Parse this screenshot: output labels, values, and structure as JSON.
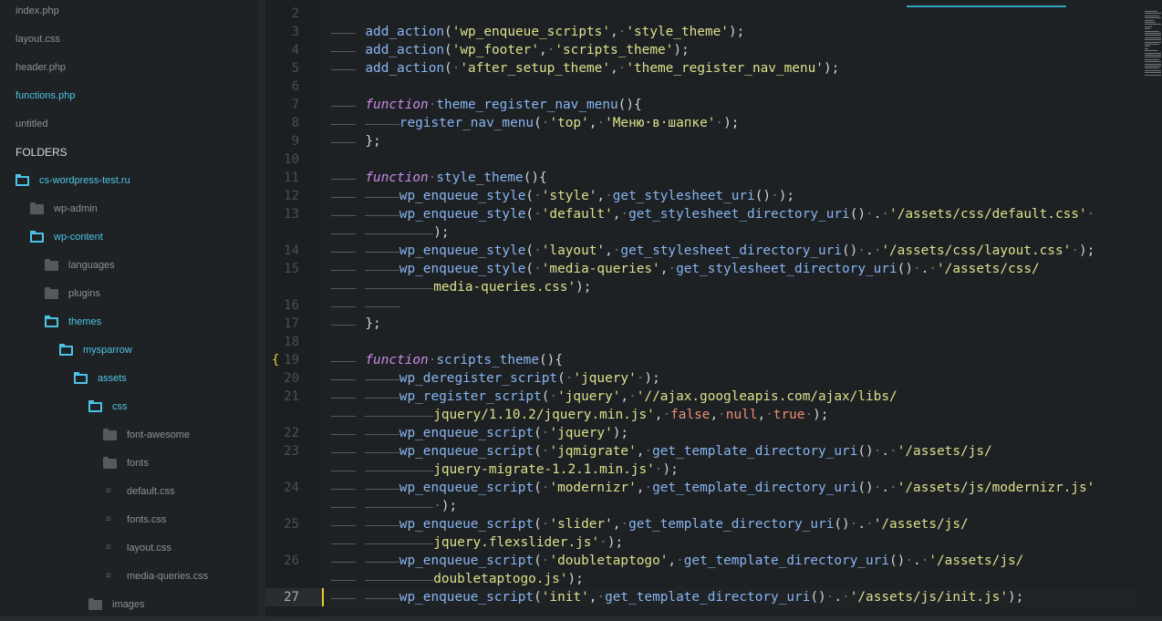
{
  "sidebar": {
    "open_files": [
      {
        "label": "index.php",
        "active": false
      },
      {
        "label": "layout.css",
        "active": false
      },
      {
        "label": "header.php",
        "active": false
      },
      {
        "label": "functions.php",
        "active": true
      },
      {
        "label": "untitled",
        "active": false
      }
    ],
    "folders_header": "FOLDERS",
    "tree": [
      {
        "label": "cs-wordpress-test.ru",
        "kind": "folder-open",
        "depth": 0
      },
      {
        "label": "wp-admin",
        "kind": "folder",
        "depth": 1
      },
      {
        "label": "wp-content",
        "kind": "folder-open",
        "depth": 1
      },
      {
        "label": "languages",
        "kind": "folder",
        "depth": 2
      },
      {
        "label": "plugins",
        "kind": "folder",
        "depth": 2
      },
      {
        "label": "themes",
        "kind": "folder-open",
        "depth": 2
      },
      {
        "label": "mysparrow",
        "kind": "folder-open",
        "depth": 3
      },
      {
        "label": "assets",
        "kind": "folder-open",
        "depth": 4
      },
      {
        "label": "css",
        "kind": "folder-open",
        "depth": 5
      },
      {
        "label": "font-awesome",
        "kind": "folder",
        "depth": 6
      },
      {
        "label": "fonts",
        "kind": "folder",
        "depth": 6
      },
      {
        "label": "default.css",
        "kind": "file",
        "depth": 6
      },
      {
        "label": "fonts.css",
        "kind": "file",
        "depth": 6
      },
      {
        "label": "layout.css",
        "kind": "file",
        "depth": 6
      },
      {
        "label": "media-queries.css",
        "kind": "file",
        "depth": 6
      },
      {
        "label": "images",
        "kind": "folder",
        "depth": 5
      }
    ]
  },
  "editor": {
    "current_line": 27,
    "fold_marker": "{",
    "fold_line": 19,
    "lines": [
      {
        "n": 2,
        "indent": 0,
        "tokens": []
      },
      {
        "n": 3,
        "indent": 1,
        "tokens": [
          [
            "fn",
            "add_action"
          ],
          [
            "p",
            "("
          ],
          [
            "str",
            "'wp_enqueue_scripts'"
          ],
          [
            "p",
            ","
          ],
          [
            "dot",
            "·"
          ],
          [
            "str",
            "'style_theme'"
          ],
          [
            "p",
            ");"
          ]
        ]
      },
      {
        "n": 4,
        "indent": 1,
        "tokens": [
          [
            "fn",
            "add_action"
          ],
          [
            "p",
            "("
          ],
          [
            "str",
            "'wp_footer'"
          ],
          [
            "p",
            ","
          ],
          [
            "dot",
            "·"
          ],
          [
            "str",
            "'scripts_theme'"
          ],
          [
            "p",
            ");"
          ]
        ]
      },
      {
        "n": 5,
        "indent": 1,
        "tokens": [
          [
            "fn",
            "add_action"
          ],
          [
            "p",
            "("
          ],
          [
            "dot",
            "·"
          ],
          [
            "str",
            "'after_setup_theme'"
          ],
          [
            "p",
            ","
          ],
          [
            "dot",
            "·"
          ],
          [
            "str",
            "'theme_register_nav_menu'"
          ],
          [
            "p",
            ");"
          ]
        ]
      },
      {
        "n": 6,
        "indent": 0,
        "tokens": []
      },
      {
        "n": 7,
        "indent": 1,
        "tokens": [
          [
            "kw",
            "function"
          ],
          [
            "dot",
            "·"
          ],
          [
            "fn",
            "theme_register_nav_menu"
          ],
          [
            "p",
            "(){"
          ]
        ]
      },
      {
        "n": 8,
        "indent": 2,
        "tokens": [
          [
            "fn",
            "register_nav_menu"
          ],
          [
            "p",
            "("
          ],
          [
            "dot",
            "·"
          ],
          [
            "str",
            "'top'"
          ],
          [
            "p",
            ","
          ],
          [
            "dot",
            "·"
          ],
          [
            "str",
            "'Меню·в·шапке'"
          ],
          [
            "dot",
            "·"
          ],
          [
            "p",
            ");"
          ]
        ]
      },
      {
        "n": 9,
        "indent": 1,
        "tokens": [
          [
            "p",
            "};"
          ]
        ]
      },
      {
        "n": 10,
        "indent": 0,
        "tokens": []
      },
      {
        "n": 11,
        "indent": 1,
        "tokens": [
          [
            "kw",
            "function"
          ],
          [
            "dot",
            "·"
          ],
          [
            "fn",
            "style_theme"
          ],
          [
            "p",
            "(){"
          ]
        ]
      },
      {
        "n": 12,
        "indent": 2,
        "tokens": [
          [
            "fn",
            "wp_enqueue_style"
          ],
          [
            "p",
            "("
          ],
          [
            "dot",
            "·"
          ],
          [
            "str",
            "'style'"
          ],
          [
            "p",
            ","
          ],
          [
            "dot",
            "·"
          ],
          [
            "fn",
            "get_stylesheet_uri"
          ],
          [
            "p",
            "()"
          ],
          [
            "dot",
            "·"
          ],
          [
            "p",
            ");"
          ]
        ]
      },
      {
        "n": 13,
        "indent": 2,
        "tokens": [
          [
            "fn",
            "wp_enqueue_style"
          ],
          [
            "p",
            "("
          ],
          [
            "dot",
            "·"
          ],
          [
            "str",
            "'default'"
          ],
          [
            "p",
            ","
          ],
          [
            "dot",
            "·"
          ],
          [
            "fn",
            "get_stylesheet_directory_uri"
          ],
          [
            "p",
            "()"
          ],
          [
            "dot",
            "·"
          ],
          [
            "p",
            "."
          ],
          [
            "dot",
            "·"
          ],
          [
            "str",
            "'/assets/css/default.css'"
          ],
          [
            "dot",
            "·"
          ]
        ]
      },
      {
        "n": null,
        "indent": 3,
        "tokens": [
          [
            "p",
            ");"
          ]
        ]
      },
      {
        "n": 14,
        "indent": 2,
        "tokens": [
          [
            "fn",
            "wp_enqueue_style"
          ],
          [
            "p",
            "("
          ],
          [
            "dot",
            "·"
          ],
          [
            "str",
            "'layout'"
          ],
          [
            "p",
            ","
          ],
          [
            "dot",
            "·"
          ],
          [
            "fn",
            "get_stylesheet_directory_uri"
          ],
          [
            "p",
            "()"
          ],
          [
            "dot",
            "·"
          ],
          [
            "p",
            "."
          ],
          [
            "dot",
            "·"
          ],
          [
            "str",
            "'/assets/css/layout.css'"
          ],
          [
            "dot",
            "·"
          ],
          [
            "p",
            ");"
          ]
        ]
      },
      {
        "n": 15,
        "indent": 2,
        "tokens": [
          [
            "fn",
            "wp_enqueue_style"
          ],
          [
            "p",
            "("
          ],
          [
            "dot",
            "·"
          ],
          [
            "str",
            "'media-queries'"
          ],
          [
            "p",
            ","
          ],
          [
            "dot",
            "·"
          ],
          [
            "fn",
            "get_stylesheet_directory_uri"
          ],
          [
            "p",
            "()"
          ],
          [
            "dot",
            "·"
          ],
          [
            "p",
            "."
          ],
          [
            "dot",
            "·"
          ],
          [
            "str",
            "'/assets/css/"
          ]
        ]
      },
      {
        "n": null,
        "indent": 3,
        "tokens": [
          [
            "str",
            "media-queries.css'"
          ],
          [
            "p",
            ");"
          ]
        ]
      },
      {
        "n": 16,
        "indent": 2,
        "tokens": []
      },
      {
        "n": 17,
        "indent": 1,
        "tokens": [
          [
            "p",
            "};"
          ]
        ]
      },
      {
        "n": 18,
        "indent": 0,
        "tokens": []
      },
      {
        "n": 19,
        "indent": 1,
        "tokens": [
          [
            "kw",
            "function"
          ],
          [
            "dot",
            "·"
          ],
          [
            "fn",
            "scripts_theme"
          ],
          [
            "p",
            "(){"
          ]
        ]
      },
      {
        "n": 20,
        "indent": 2,
        "tokens": [
          [
            "fn",
            "wp_deregister_script"
          ],
          [
            "p",
            "("
          ],
          [
            "dot",
            "·"
          ],
          [
            "str",
            "'jquery'"
          ],
          [
            "dot",
            "·"
          ],
          [
            "p",
            ");"
          ]
        ]
      },
      {
        "n": 21,
        "indent": 2,
        "tokens": [
          [
            "fn",
            "wp_register_script"
          ],
          [
            "p",
            "("
          ],
          [
            "dot",
            "·"
          ],
          [
            "str",
            "'jquery'"
          ],
          [
            "p",
            ","
          ],
          [
            "dot",
            "·"
          ],
          [
            "str",
            "'//ajax.googleapis.com/ajax/libs/"
          ]
        ]
      },
      {
        "n": null,
        "indent": 3,
        "tokens": [
          [
            "str",
            "jquery/1.10.2/jquery.min.js'"
          ],
          [
            "p",
            ","
          ],
          [
            "dot",
            "·"
          ],
          [
            "lit",
            "false"
          ],
          [
            "p",
            ","
          ],
          [
            "dot",
            "·"
          ],
          [
            "lit",
            "null"
          ],
          [
            "p",
            ","
          ],
          [
            "dot",
            "·"
          ],
          [
            "lit",
            "true"
          ],
          [
            "dot",
            "·"
          ],
          [
            "p",
            ");"
          ]
        ]
      },
      {
        "n": 22,
        "indent": 2,
        "tokens": [
          [
            "fn",
            "wp_enqueue_script"
          ],
          [
            "p",
            "("
          ],
          [
            "dot",
            "·"
          ],
          [
            "str",
            "'jquery'"
          ],
          [
            "p",
            ");"
          ]
        ]
      },
      {
        "n": 23,
        "indent": 2,
        "tokens": [
          [
            "fn",
            "wp_enqueue_script"
          ],
          [
            "p",
            "("
          ],
          [
            "dot",
            "·"
          ],
          [
            "str",
            "'jqmigrate'"
          ],
          [
            "p",
            ","
          ],
          [
            "dot",
            "·"
          ],
          [
            "fn",
            "get_template_directory_uri"
          ],
          [
            "p",
            "()"
          ],
          [
            "dot",
            "·"
          ],
          [
            "p",
            "."
          ],
          [
            "dot",
            "·"
          ],
          [
            "str",
            "'/assets/js/"
          ]
        ]
      },
      {
        "n": null,
        "indent": 3,
        "tokens": [
          [
            "str",
            "jquery-migrate-1.2.1.min.js'"
          ],
          [
            "dot",
            "·"
          ],
          [
            "p",
            ");"
          ]
        ]
      },
      {
        "n": 24,
        "indent": 2,
        "tokens": [
          [
            "fn",
            "wp_enqueue_script"
          ],
          [
            "p",
            "("
          ],
          [
            "dot",
            "·"
          ],
          [
            "str",
            "'modernizr'"
          ],
          [
            "p",
            ","
          ],
          [
            "dot",
            "·"
          ],
          [
            "fn",
            "get_template_directory_uri"
          ],
          [
            "p",
            "()"
          ],
          [
            "dot",
            "·"
          ],
          [
            "p",
            "."
          ],
          [
            "dot",
            "·"
          ],
          [
            "str",
            "'/assets/js/modernizr.js'"
          ]
        ]
      },
      {
        "n": null,
        "indent": 3,
        "tokens": [
          [
            "dot",
            "·"
          ],
          [
            "p",
            ");"
          ]
        ]
      },
      {
        "n": 25,
        "indent": 2,
        "tokens": [
          [
            "fn",
            "wp_enqueue_script"
          ],
          [
            "p",
            "("
          ],
          [
            "dot",
            "·"
          ],
          [
            "str",
            "'slider'"
          ],
          [
            "p",
            ","
          ],
          [
            "dot",
            "·"
          ],
          [
            "fn",
            "get_template_directory_uri"
          ],
          [
            "p",
            "()"
          ],
          [
            "dot",
            "·"
          ],
          [
            "p",
            "."
          ],
          [
            "dot",
            "·"
          ],
          [
            "str",
            "'/assets/js/"
          ]
        ]
      },
      {
        "n": null,
        "indent": 3,
        "tokens": [
          [
            "str",
            "jquery.flexslider.js'"
          ],
          [
            "dot",
            "·"
          ],
          [
            "p",
            ");"
          ]
        ]
      },
      {
        "n": 26,
        "indent": 2,
        "tokens": [
          [
            "fn",
            "wp_enqueue_script"
          ],
          [
            "p",
            "("
          ],
          [
            "dot",
            "·"
          ],
          [
            "str",
            "'doubletaptogo'"
          ],
          [
            "p",
            ","
          ],
          [
            "dot",
            "·"
          ],
          [
            "fn",
            "get_template_directory_uri"
          ],
          [
            "p",
            "()"
          ],
          [
            "dot",
            "·"
          ],
          [
            "p",
            "."
          ],
          [
            "dot",
            "·"
          ],
          [
            "str",
            "'/assets/js/"
          ]
        ]
      },
      {
        "n": null,
        "indent": 3,
        "tokens": [
          [
            "str",
            "doubletaptogo.js'"
          ],
          [
            "p",
            ");"
          ]
        ]
      },
      {
        "n": 27,
        "indent": 2,
        "tokens": [
          [
            "fn",
            "wp_enqueue_script"
          ],
          [
            "p",
            "("
          ],
          [
            "str",
            "'init'"
          ],
          [
            "p",
            ","
          ],
          [
            "dot",
            "·"
          ],
          [
            "fn",
            "get_template_directory_uri"
          ],
          [
            "p",
            "()"
          ],
          [
            "dot",
            "·"
          ],
          [
            "p",
            "."
          ],
          [
            "dot",
            "·"
          ],
          [
            "str",
            "'/assets/js/init.js'"
          ],
          [
            "p",
            ");"
          ]
        ]
      }
    ]
  },
  "colors": {
    "function": "#87b5f0",
    "string": "#dbe08b",
    "keyword": "#cb8ae6",
    "literal": "#ee8e75",
    "accent": "#4cc3e6",
    "fold_marker": "#e6cd2a"
  }
}
